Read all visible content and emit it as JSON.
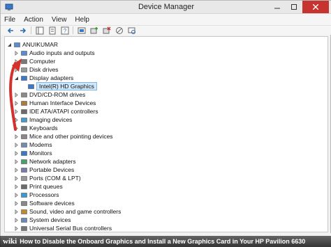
{
  "window": {
    "title": "Device Manager"
  },
  "menu": [
    {
      "name": "menu-file",
      "label": "File"
    },
    {
      "name": "menu-action",
      "label": "Action"
    },
    {
      "name": "menu-view",
      "label": "View"
    },
    {
      "name": "menu-help",
      "label": "Help"
    }
  ],
  "toolbar_icons": [
    "back-arrow-icon",
    "forward-arrow-icon",
    "show-hide-tree-icon",
    "properties-icon",
    "help-icon",
    "show-hidden-icon",
    "update-driver-icon",
    "uninstall-icon",
    "disable-icon",
    "scan-hardware-icon"
  ],
  "tree": {
    "root": "ANUIKUMAR",
    "categories": [
      {
        "label": "Audio inputs and outputs",
        "icon": "speaker-icon"
      },
      {
        "label": "Computer",
        "icon": "computer-icon"
      },
      {
        "label": "Disk drives",
        "icon": "disk-drive-icon"
      },
      {
        "label": "Display adapters",
        "icon": "display-adapter-icon",
        "expanded": true,
        "children": [
          "Intel(R) HD Graphics"
        ]
      },
      {
        "label": "DVD/CD-ROM drives",
        "icon": "dvd-drive-icon"
      },
      {
        "label": "Human Interface Devices",
        "icon": "hid-icon"
      },
      {
        "label": "IDE ATA/ATAPI controllers",
        "icon": "ide-controller-icon"
      },
      {
        "label": "Imaging devices",
        "icon": "camera-icon"
      },
      {
        "label": "Keyboards",
        "icon": "keyboard-icon"
      },
      {
        "label": "Mice and other pointing devices",
        "icon": "mouse-icon"
      },
      {
        "label": "Modems",
        "icon": "modem-icon"
      },
      {
        "label": "Monitors",
        "icon": "monitor-icon"
      },
      {
        "label": "Network adapters",
        "icon": "network-adapter-icon"
      },
      {
        "label": "Portable Devices",
        "icon": "portable-device-icon"
      },
      {
        "label": "Ports (COM & LPT)",
        "icon": "port-icon"
      },
      {
        "label": "Print queues",
        "icon": "printer-icon"
      },
      {
        "label": "Processors",
        "icon": "processor-icon"
      },
      {
        "label": "Software devices",
        "icon": "software-device-icon"
      },
      {
        "label": "Sound, video and game controllers",
        "icon": "sound-controller-icon"
      },
      {
        "label": "System devices",
        "icon": "system-device-icon"
      },
      {
        "label": "Universal Serial Bus controllers",
        "icon": "usb-icon"
      }
    ]
  },
  "caption": {
    "brand": "wiki",
    "text": "How to Disable the Onboard Graphics and Install a New Graphics Card in Your HP Pavilion 6630"
  }
}
